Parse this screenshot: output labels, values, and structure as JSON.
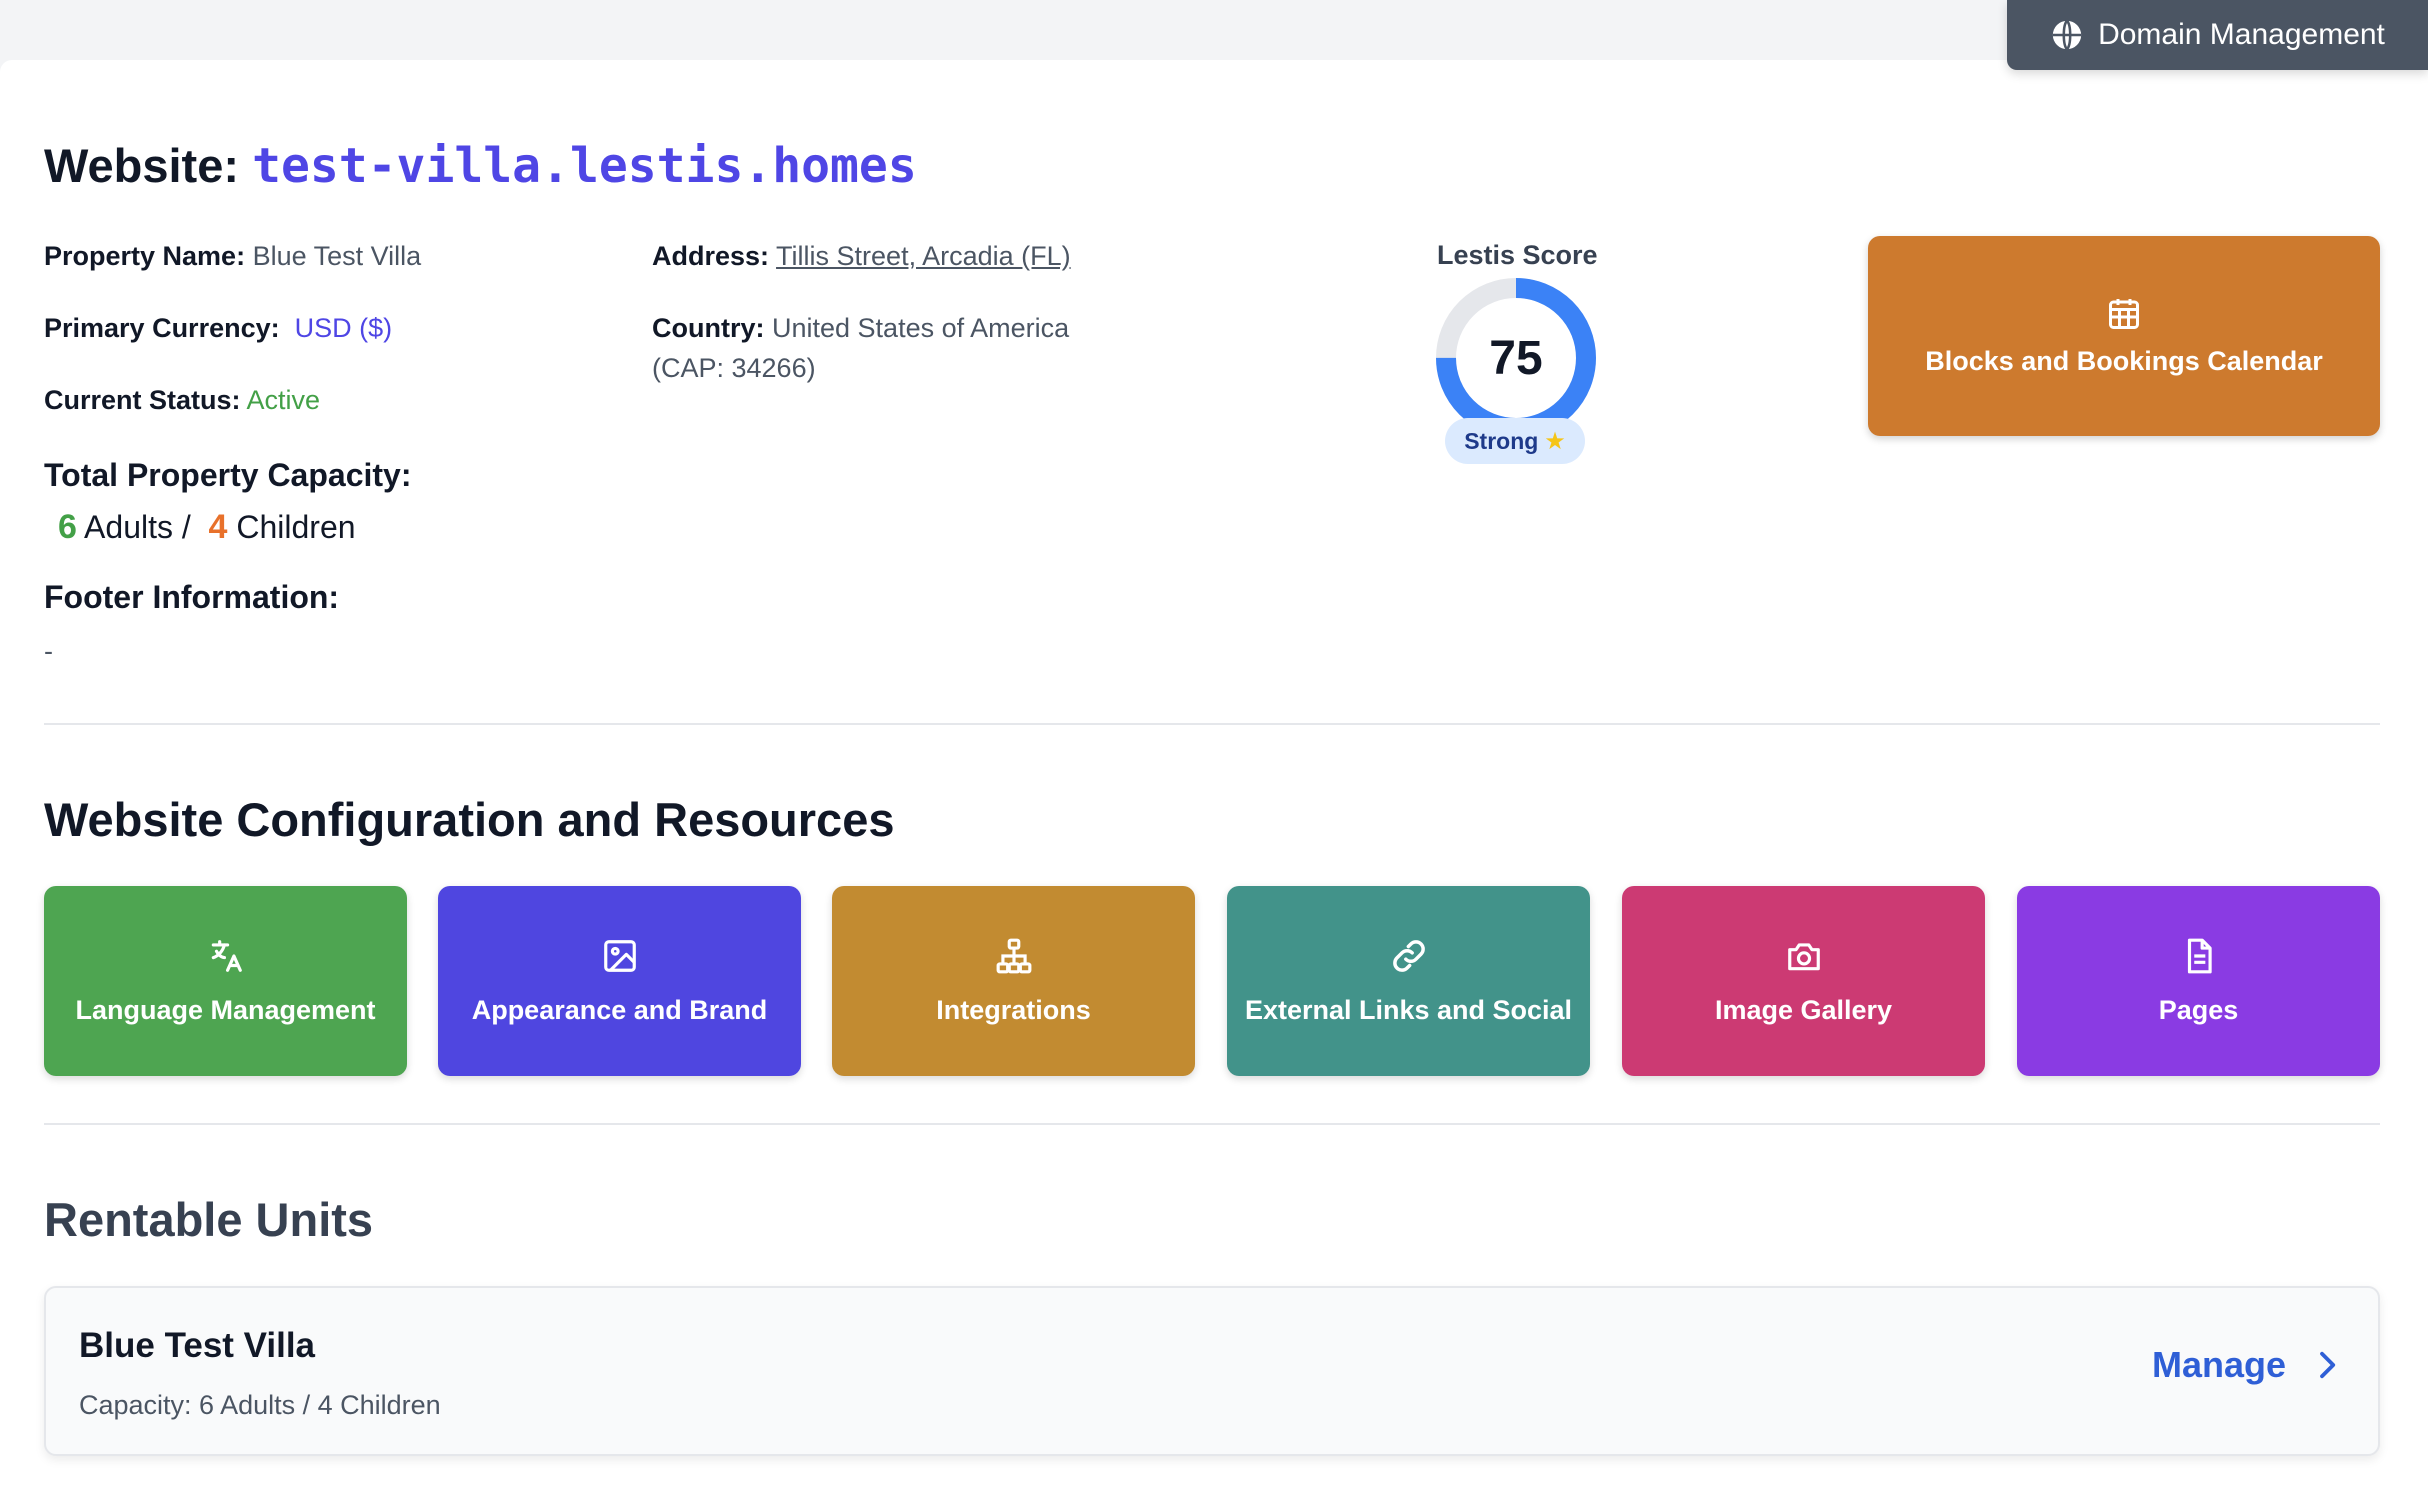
{
  "domain_button": {
    "label": "Domain Management",
    "icon": "globe-icon"
  },
  "header": {
    "title_prefix": "Website:",
    "domain": "test-villa.lestis.homes"
  },
  "property": {
    "name_label": "Property Name:",
    "name_value": "Blue Test Villa",
    "currency_label": "Primary Currency:",
    "currency_value": "USD ($)",
    "status_label": "Current Status:",
    "status_value": "Active",
    "address_label": "Address:",
    "address_value": "Tillis Street, Arcadia (FL)",
    "country_label": "Country:",
    "country_value": "United States of America",
    "cap_code": "(CAP: 34266)"
  },
  "capacity": {
    "title": "Total Property Capacity:",
    "adults": "6",
    "adults_label": "Adults /",
    "children": "4",
    "children_label": "Children"
  },
  "footer_info": {
    "title": "Footer Information:",
    "value": "-"
  },
  "score": {
    "label": "Lestis Score",
    "value": "75",
    "fill_fraction": 0.75,
    "badge": "Strong",
    "badge_icon": "star-icon"
  },
  "calendar_button": {
    "label": "Blocks and Bookings Calendar",
    "icon": "calendar-icon",
    "color": "#cd7a2e"
  },
  "config_section": {
    "title": "Website Configuration and Resources",
    "tiles": [
      {
        "label": "Language Management",
        "icon": "translate-icon",
        "color": "#4ea551"
      },
      {
        "label": "Appearance and Brand",
        "icon": "image-icon",
        "color": "#4f46e0"
      },
      {
        "label": "Integrations",
        "icon": "network-icon",
        "color": "#c28b31"
      },
      {
        "label": "External Links and Social",
        "icon": "link-icon",
        "color": "#42938a"
      },
      {
        "label": "Image Gallery",
        "icon": "camera-icon",
        "color": "#cc3a73"
      },
      {
        "label": "Pages",
        "icon": "document-icon",
        "color": "#8a3be3"
      }
    ]
  },
  "units_section": {
    "title": "Rentable Units",
    "units": [
      {
        "name": "Blue Test Villa",
        "capacity": "Capacity: 6 Adults / 4 Children",
        "action": "Manage",
        "action_icon": "chevron-right-icon"
      }
    ]
  }
}
